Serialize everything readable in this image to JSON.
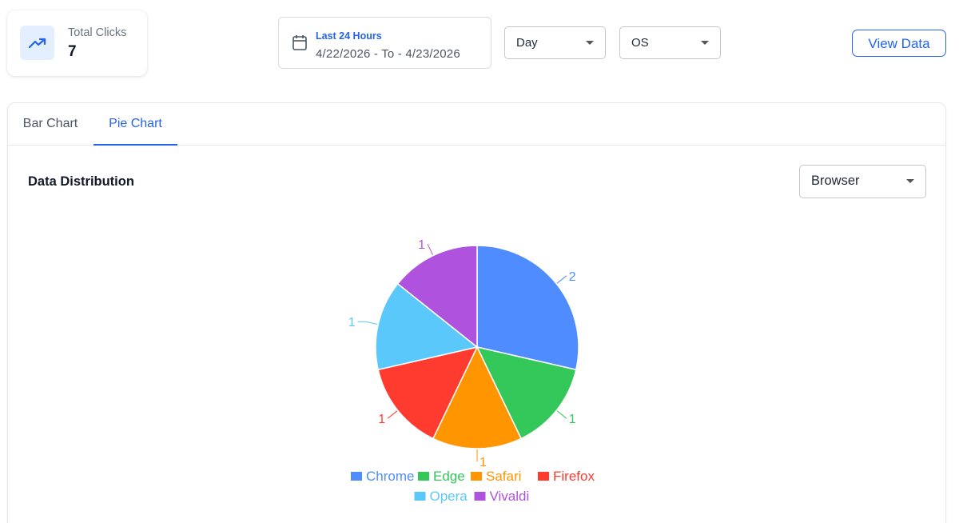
{
  "stats": {
    "total_clicks_label": "Total Clicks",
    "total_clicks_value": "7",
    "icon": "trending-up-icon"
  },
  "date_range": {
    "preset": "Last 24 Hours",
    "range": "4/22/2026 - To - 4/23/2026",
    "icon": "calendar-icon"
  },
  "filters": {
    "interval": "Day",
    "dimension": "OS"
  },
  "view_data_label": "View Data",
  "tabs": [
    {
      "label": "Bar Chart",
      "active": false
    },
    {
      "label": "Pie Chart",
      "active": true
    }
  ],
  "section": {
    "title": "Data Distribution",
    "breakdown": "Browser"
  },
  "colors": {
    "accent": "#2563eb"
  },
  "chart_data": {
    "type": "pie",
    "title": "",
    "categories": [
      "Chrome",
      "Edge",
      "Safari",
      "Firefox",
      "Opera",
      "Vivaldi"
    ],
    "values": [
      2,
      1,
      1,
      1,
      1,
      1
    ],
    "colors": [
      "#4e8cff",
      "#34c759",
      "#ff9500",
      "#ff3b30",
      "#5ac8fa",
      "#af52de"
    ],
    "legend": "bottom",
    "data_labels": true
  }
}
